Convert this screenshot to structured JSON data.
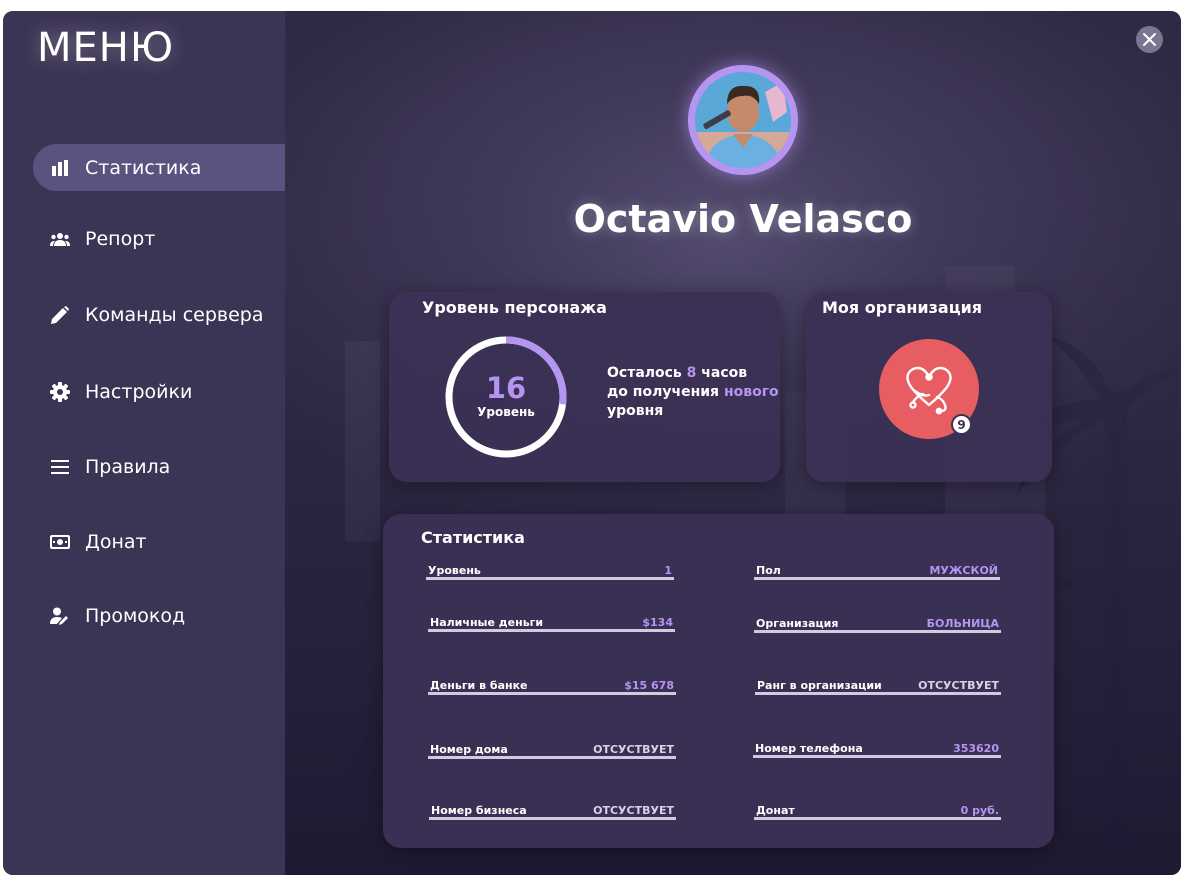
{
  "sidebar": {
    "title": "МЕНЮ",
    "items": [
      {
        "label": "Статистика",
        "icon": "bar-chart-icon",
        "active": true
      },
      {
        "label": "Репорт",
        "icon": "users-icon",
        "active": false
      },
      {
        "label": "Команды сервера",
        "icon": "pencil-icon",
        "active": false
      },
      {
        "label": "Настройки",
        "icon": "gear-icon",
        "active": false
      },
      {
        "label": "Правила",
        "icon": "list-icon",
        "active": false
      },
      {
        "label": "Донат",
        "icon": "money-icon",
        "active": false
      },
      {
        "label": "Промокод",
        "icon": "user-edit-icon",
        "active": false
      }
    ]
  },
  "player": {
    "name": "Octavio Velasco"
  },
  "level_card": {
    "title": "Уровень персонажа",
    "level": "16",
    "level_label": "Уровень",
    "progress_fraction": 0.27,
    "text_before": "Осталось",
    "hours": "8",
    "text_hours": "часов",
    "text_mid": "до получения",
    "text_new": "нового",
    "text_end": "уровня"
  },
  "org_card": {
    "title": "Моя организация",
    "icon": "stethoscope-heart-icon",
    "count": "9",
    "color": "#e85d62"
  },
  "stats_card": {
    "title": "Статистика",
    "rows": [
      {
        "label": "Уровень",
        "value": "1"
      },
      {
        "label": "Пол",
        "value": "МУЖСКОЙ"
      },
      {
        "label": "Наличные деньги",
        "value": "$134"
      },
      {
        "label": "Организация",
        "value": "БОЛЬНИЦА"
      },
      {
        "label": "Деньги в банке",
        "value": "$15 678"
      },
      {
        "label": "Ранг в организации",
        "value": "ОТСУСТВУЕТ"
      },
      {
        "label": "Номер дома",
        "value": "ОТСУСТВУЕТ"
      },
      {
        "label": "Номер телефона",
        "value": "353620"
      },
      {
        "label": "Номер бизнеса",
        "value": "ОТСУСТВУЕТ"
      },
      {
        "label": "Донат",
        "value": "0 руб."
      }
    ]
  },
  "colors": {
    "accent": "#b594f2",
    "sidebar": "#3c3454",
    "card": "#3a3154",
    "active_item": "#5c5280"
  }
}
